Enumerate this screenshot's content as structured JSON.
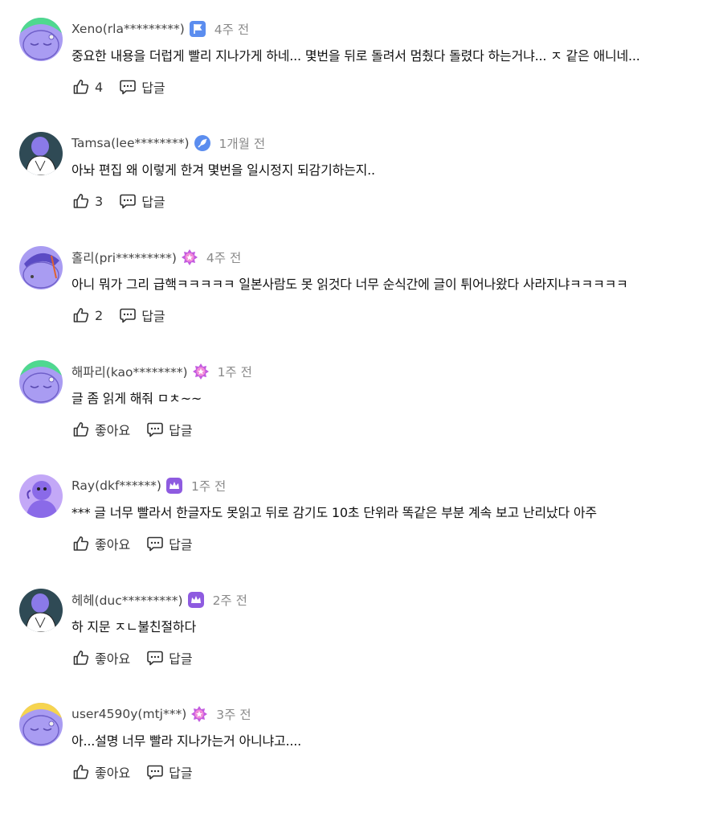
{
  "comments": [
    {
      "username": "Xeno(rla*********)",
      "time": "4주 전",
      "text": "중요한 내용을 더럽게 빨리 지나가게 하네... 몇번을 뒤로 돌려서 멈췄다 돌렸다 하는거냐... ㅈ 같은 애니네...",
      "like_label": "4",
      "reply_label": "답글",
      "badge_icon": "flag-badge-icon",
      "avatar_color": "#9b8cf0"
    },
    {
      "username": "Tamsa(lee********)",
      "time": "1개월 전",
      "text": "아놔 편집 왜 이렇게 한겨 몇번을 일시정지 되감기하는지..",
      "like_label": "3",
      "reply_label": "답글",
      "badge_icon": "feather-badge-icon",
      "avatar_color": "#2f4a55"
    },
    {
      "username": "홀리(pri*********)",
      "time": "4주 전",
      "text": "아니 뭐가 그리 급핵ㅋㅋㅋㅋㅋ 일본사람도 못 읽것다 너무 순식간에 글이 튀어나왔다 사라지냐ㅋㅋㅋㅋㅋ",
      "like_label": "2",
      "reply_label": "답글",
      "badge_icon": "star-badge-icon",
      "avatar_color": "#9b8cf0"
    },
    {
      "username": "해파리(kao********)",
      "time": "1주 전",
      "text": "글 좀 읽게 해줘 ㅁㅊ~~",
      "like_label": "좋아요",
      "reply_label": "답글",
      "badge_icon": "star-badge-icon",
      "avatar_color": "#9b8cf0"
    },
    {
      "username": "Ray(dkf******)",
      "time": "1주 전",
      "text": "*** 글 너무 빨라서 한글자도 못읽고 뒤로 감기도 10초 단위라 똑같은 부분 계속 보고 난리났다 아주",
      "like_label": "좋아요",
      "reply_label": "답글",
      "badge_icon": "crown-badge-icon",
      "avatar_color": "#b08cf5"
    },
    {
      "username": "헤헤(duc*********)",
      "time": "2주 전",
      "text": "하 지문 ㅈㄴ불친절하다",
      "like_label": "좋아요",
      "reply_label": "답글",
      "badge_icon": "crown-badge-icon",
      "avatar_color": "#2f4a55"
    },
    {
      "username": "user4590y(mtj***)",
      "time": "3주 전",
      "text": "아...설명 너무 빨라 지나가는거 아니냐고....",
      "like_label": "좋아요",
      "reply_label": "답글",
      "badge_icon": "star-badge-icon",
      "avatar_color": "#9b8cf0"
    }
  ]
}
